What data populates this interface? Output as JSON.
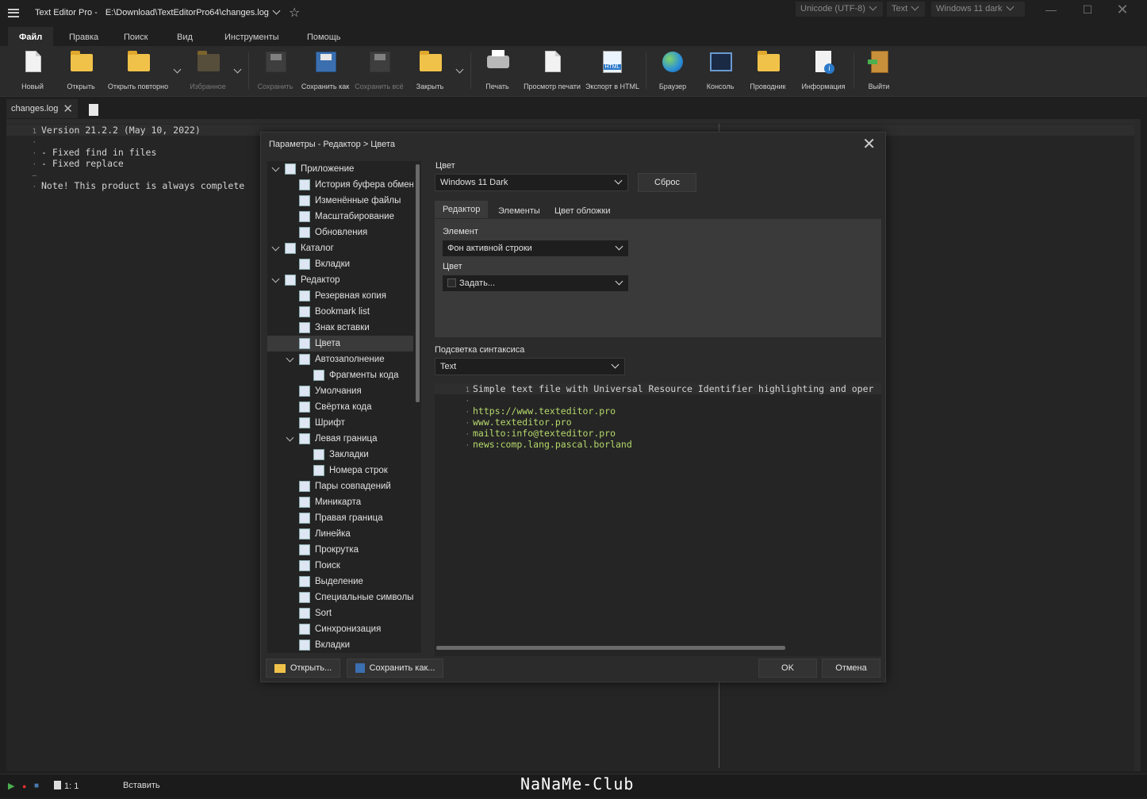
{
  "window": {
    "app_title": "Text Editor Pro  -",
    "file_path": "E:\\Download\\TextEditorPro64\\changes.log",
    "encoding": "Unicode (UTF-8)",
    "highlighter": "Text",
    "theme": "Windows 11 dark"
  },
  "ribbon_tabs": [
    "Файл",
    "Правка",
    "Поиск",
    "Вид",
    "Инструменты",
    "Помощь"
  ],
  "ribbon": {
    "new": "Новый",
    "open": "Открыть",
    "reopen": "Открыть повторно",
    "favorites": "Избранное",
    "save": "Сохранить",
    "save_as": "Сохранить как",
    "save_all": "Сохранить всё",
    "close": "Закрыть",
    "print": "Печать",
    "print_preview": "Просмотр печати",
    "export_html": "Экспорт в HTML",
    "browser": "Браузер",
    "console": "Консоль",
    "explorer": "Проводник",
    "info": "Информация",
    "exit": "Выйти"
  },
  "doc_tab": {
    "name": "changes.log"
  },
  "editor_lines": [
    {
      "num": "1",
      "text": "Version 21.2.2 (May 10, 2022)"
    },
    {
      "num": "·",
      "text": ""
    },
    {
      "num": "·",
      "text": "- Fixed find in files"
    },
    {
      "num": "·",
      "text": "- Fixed replace"
    },
    {
      "num": "–",
      "text": ""
    },
    {
      "num": "·",
      "text": "Note! This product is always complete"
    }
  ],
  "status": {
    "position": "1: 1",
    "mode": "Вставить"
  },
  "watermark": "NaNaMe-Club",
  "dialog": {
    "breadcrumb": "Параметры  -  Редактор  >  Цвета",
    "tree": [
      {
        "label": "Приложение",
        "level": 0,
        "expanded": true
      },
      {
        "label": "История буфера обмена",
        "level": 1
      },
      {
        "label": "Изменённые файлы",
        "level": 1
      },
      {
        "label": "Масштабирование",
        "level": 1
      },
      {
        "label": "Обновления",
        "level": 1
      },
      {
        "label": "Каталог",
        "level": 0,
        "expanded": true
      },
      {
        "label": "Вкладки",
        "level": 1
      },
      {
        "label": "Редактор",
        "level": 0,
        "expanded": true
      },
      {
        "label": "Резервная копия",
        "level": 1
      },
      {
        "label": "Bookmark list",
        "level": 1
      },
      {
        "label": "Знак вставки",
        "level": 1
      },
      {
        "label": "Цвета",
        "level": 1,
        "selected": true
      },
      {
        "label": "Автозаполнение",
        "level": 1,
        "expanded": true
      },
      {
        "label": "Фрагменты кода",
        "level": 2
      },
      {
        "label": "Умолчания",
        "level": 1
      },
      {
        "label": "Свёртка кода",
        "level": 1
      },
      {
        "label": "Шрифт",
        "level": 1
      },
      {
        "label": "Левая граница",
        "level": 1,
        "expanded": true
      },
      {
        "label": "Закладки",
        "level": 2
      },
      {
        "label": "Номера строк",
        "level": 2
      },
      {
        "label": "Пары совпадений",
        "level": 1
      },
      {
        "label": "Миникарта",
        "level": 1
      },
      {
        "label": "Правая граница",
        "level": 1
      },
      {
        "label": "Линейка",
        "level": 1
      },
      {
        "label": "Прокрутка",
        "level": 1
      },
      {
        "label": "Поиск",
        "level": 1
      },
      {
        "label": "Выделение",
        "level": 1
      },
      {
        "label": "Специальные символы",
        "level": 1
      },
      {
        "label": "Sort",
        "level": 1
      },
      {
        "label": "Синхронизация",
        "level": 1
      },
      {
        "label": "Вкладки",
        "level": 1
      }
    ],
    "color_label": "Цвет",
    "color_scheme": "Windows 11 Dark",
    "reset": "Сброс",
    "inner_tabs": [
      "Редактор",
      "Элементы",
      "Цвет обложки"
    ],
    "element_label": "Элемент",
    "element_value": "Фон активной строки",
    "color2_label": "Цвет",
    "color2_value": "Задать...",
    "syntax_label": "Подсветка синтаксиса",
    "syntax_value": "Text",
    "preview_lines": [
      {
        "num": "1",
        "text": "Simple text file with Universal Resource Identifier highlighting and oper",
        "url": false
      },
      {
        "num": "·",
        "text": "",
        "url": false
      },
      {
        "num": "·",
        "text": "https://www.texteditor.pro",
        "url": true
      },
      {
        "num": "·",
        "text": "www.texteditor.pro",
        "url": true
      },
      {
        "num": "·",
        "text": "mailto:info@texteditor.pro",
        "url": true
      },
      {
        "num": "·",
        "text": "news:comp.lang.pascal.borland",
        "url": true
      }
    ],
    "open_btn": "Открыть...",
    "saveas_btn": "Сохранить как...",
    "ok": "OK",
    "cancel": "Отмена"
  }
}
